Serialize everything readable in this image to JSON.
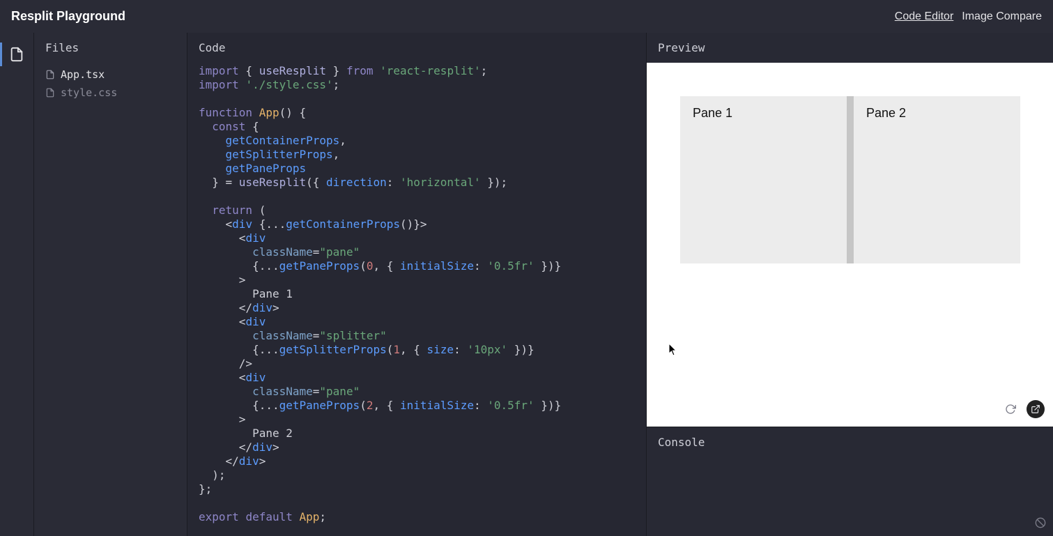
{
  "header": {
    "title": "Resplit Playground",
    "nav": [
      {
        "label": "Code Editor",
        "active": true
      },
      {
        "label": "Image Compare",
        "active": false
      }
    ]
  },
  "sidebar": {
    "label": "Files"
  },
  "files": [
    {
      "name": "App.tsx",
      "active": true
    },
    {
      "name": "style.css",
      "active": false
    }
  ],
  "panels": {
    "code": "Code",
    "preview": "Preview",
    "console": "Console"
  },
  "preview": {
    "pane1": "Pane 1",
    "pane2": "Pane 2"
  },
  "code": {
    "tokens": {
      "import": "import",
      "from": "from",
      "function": "function",
      "const": "const",
      "return": "return",
      "export": "export",
      "default": "default",
      "useResplit": "useResplit",
      "react_resplit": "'react-resplit'",
      "style_css": "'./style.css'",
      "App": "App",
      "getContainerProps": "getContainerProps",
      "getSplitterProps": "getSplitterProps",
      "getPaneProps": "getPaneProps",
      "direction": "direction",
      "horizontal": "'horizontal'",
      "div": "div",
      "className": "className",
      "pane": "\"pane\"",
      "splitter": "\"splitter\"",
      "initialSize": "initialSize",
      "half_fr": "'0.5fr'",
      "size": "size",
      "ten_px": "'10px'",
      "zero": "0",
      "one": "1",
      "two": "2",
      "pane1_text": "Pane 1",
      "pane2_text": "Pane 2"
    }
  }
}
